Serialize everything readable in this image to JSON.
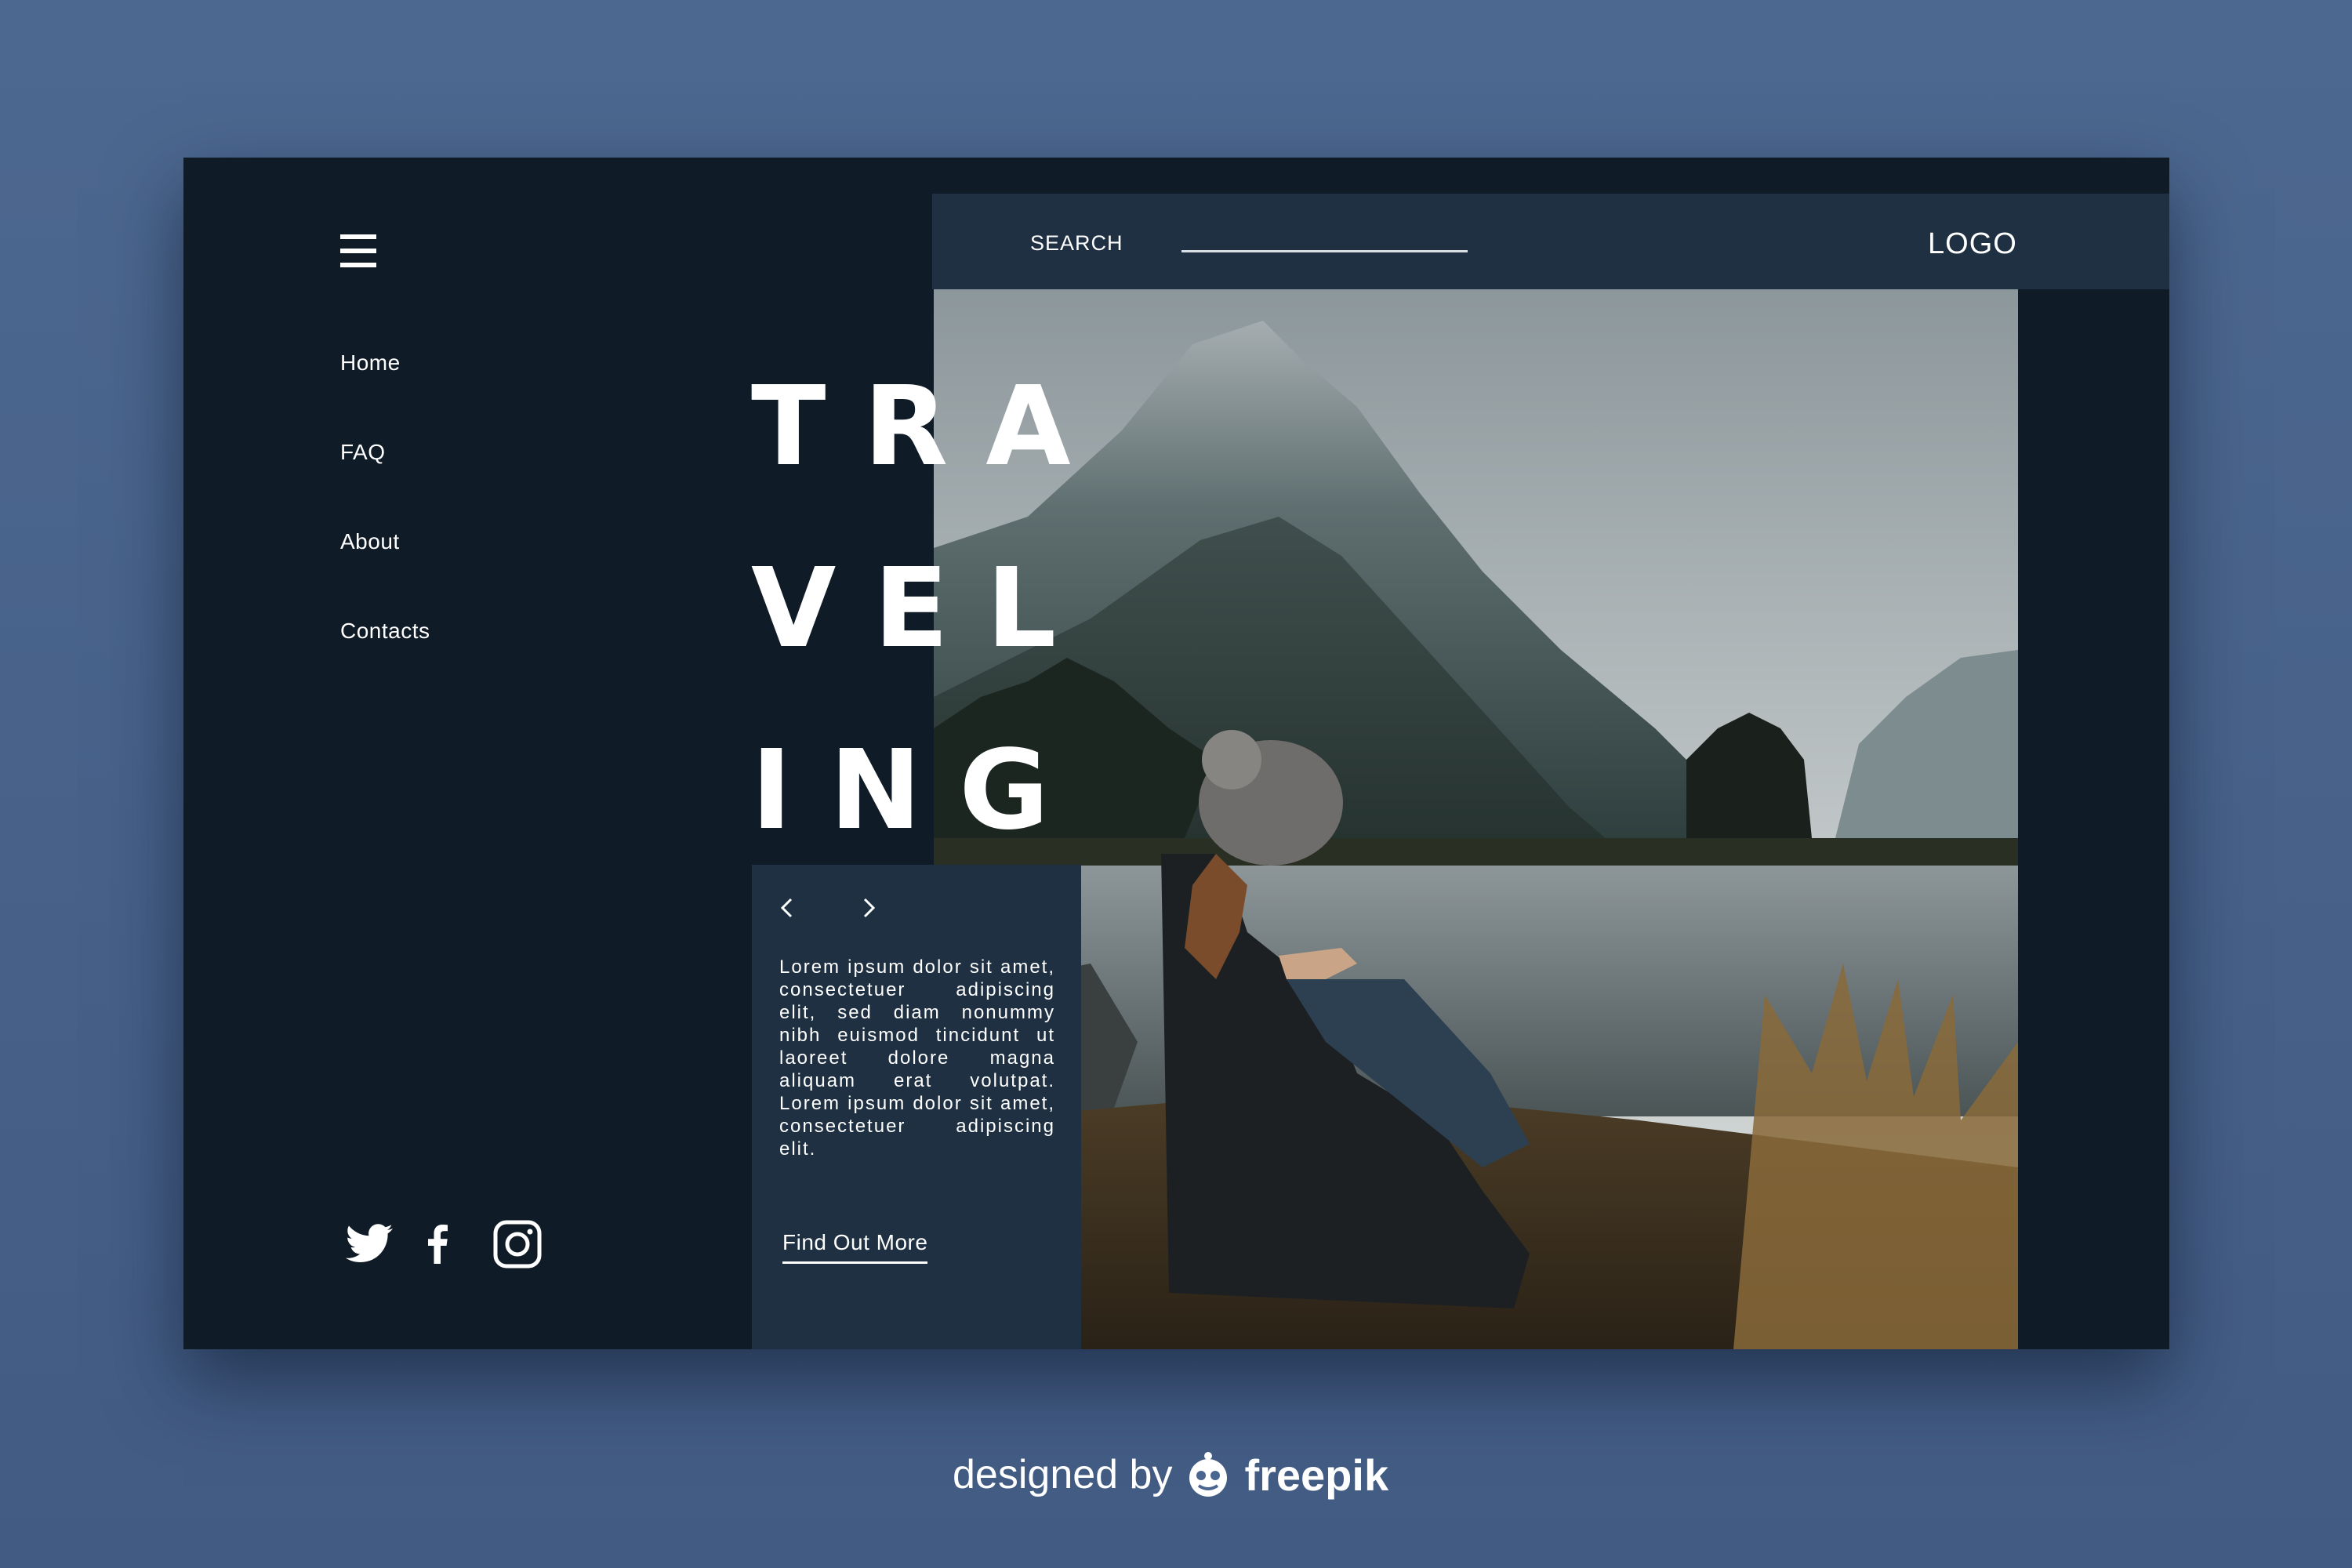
{
  "nav": {
    "items": [
      "Home",
      "FAQ",
      "About",
      "Contacts"
    ]
  },
  "header": {
    "search_label": "SEARCH",
    "logo": "LOGO"
  },
  "hero": {
    "title_lines": [
      "TRA",
      "VEL",
      "ING"
    ],
    "body": "Lorem ipsum dolor sit amet, consectetuer adipiscing elit, sed diam nonummy nibh euismod tincidunt ut laoreet dolore magna aliquam erat volutpat. Lorem ipsum dolor sit amet, consectetuer adipiscing elit.",
    "cta": "Find Out More"
  },
  "social": [
    "twitter-icon",
    "facebook-icon",
    "instagram-icon"
  ],
  "credit": {
    "prefix": "designed by",
    "brand": "freepik"
  },
  "colors": {
    "page_bg": "#4a6590",
    "frame_bg": "#0f1b26",
    "panel_bg": "#1e3041",
    "text": "#ffffff"
  }
}
